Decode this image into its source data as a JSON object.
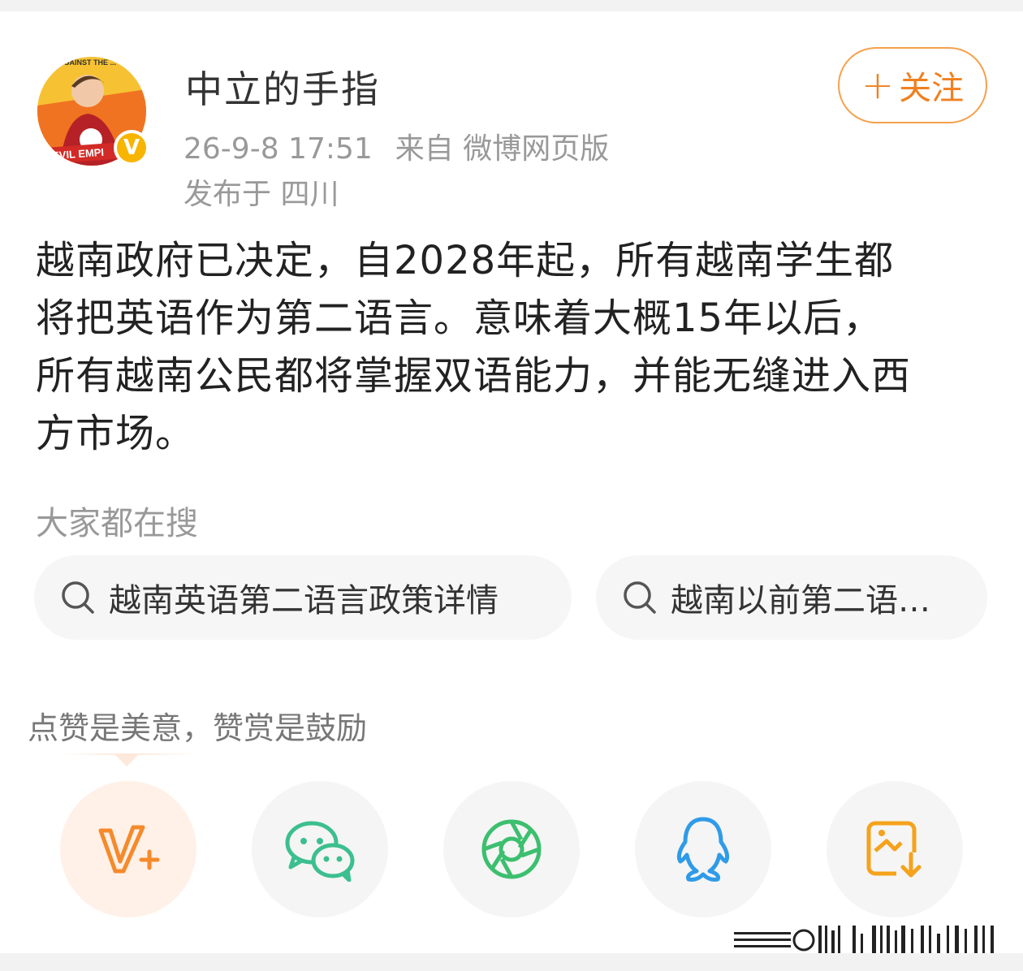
{
  "user": {
    "name": "中立的手指",
    "avatar_text_top": "AGAINST THE ...",
    "avatar_text_bottom": "EVIL EMPI",
    "verified_mark": "V"
  },
  "meta": {
    "time": "26-9-8 17:51",
    "source": "来自 微博网页版",
    "location": "发布于 四川"
  },
  "follow_button": {
    "plus": "+",
    "label": "关注"
  },
  "post": {
    "lines": [
      "越南政府已决定，自2028年起，所有越南学生都",
      "将把英语作为第二语言。意味着大概15年以后，",
      "所有越南公民都将掌握双语能力，并能无缝进入西",
      "方市场。"
    ]
  },
  "search": {
    "heading": "大家都在搜",
    "items": [
      {
        "label": "越南英语第二语言政策详情",
        "icon": "search-icon"
      },
      {
        "label": "越南以前第二语…",
        "icon": "search-icon"
      }
    ]
  },
  "reward": {
    "text": "点赞是美意，赞赏是鼓励"
  },
  "share": {
    "items": [
      {
        "name": "v-plus-icon",
        "color": "#f58a2b"
      },
      {
        "name": "wechat-icon",
        "color": "#3cbf8f"
      },
      {
        "name": "moments-icon",
        "color": "#3cbf6f"
      },
      {
        "name": "qq-icon",
        "color": "#2f9be8"
      },
      {
        "name": "save-image-icon",
        "color": "#f5a21c"
      }
    ]
  }
}
